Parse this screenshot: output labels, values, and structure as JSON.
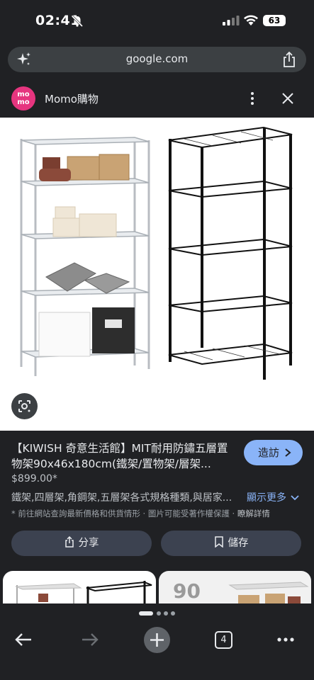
{
  "status": {
    "time": "02:41",
    "battery": "63"
  },
  "browser": {
    "url": "google.com",
    "tab_count": "4"
  },
  "source": {
    "logo_text": "mo\nmo",
    "name": "Momo購物"
  },
  "product": {
    "title": "【KIWISH 奇意生活館】MIT耐用防鏽五層置物架90x46x180cm(鐵架/置物架/層架...",
    "visit_label": "造訪",
    "price": "$899.00*",
    "description": "鐵架,四層架,角鋼架,五層架各式規格種類,與居家...",
    "show_more": "顯示更多",
    "disclaimer": "* 前往網站查詢最新價格和供貨情形 · 圖片可能受著作權保護 · ",
    "disclaimer_link": "瞭解詳情",
    "share_label": "分享",
    "save_label": "儲存"
  },
  "related": {
    "card2_badge": "90"
  },
  "icons": {
    "lens": "lens-icon",
    "sparkle": "sparkle-icon",
    "share": "share-icon",
    "close": "close-icon",
    "more": "more-vert-icon",
    "bookmark": "bookmark-icon",
    "back": "arrow-back-icon",
    "forward": "arrow-forward-icon",
    "add": "plus-icon"
  },
  "colors": {
    "accent": "#8ab4f8",
    "background": "#202124",
    "momo_pink": "#e6357f"
  }
}
